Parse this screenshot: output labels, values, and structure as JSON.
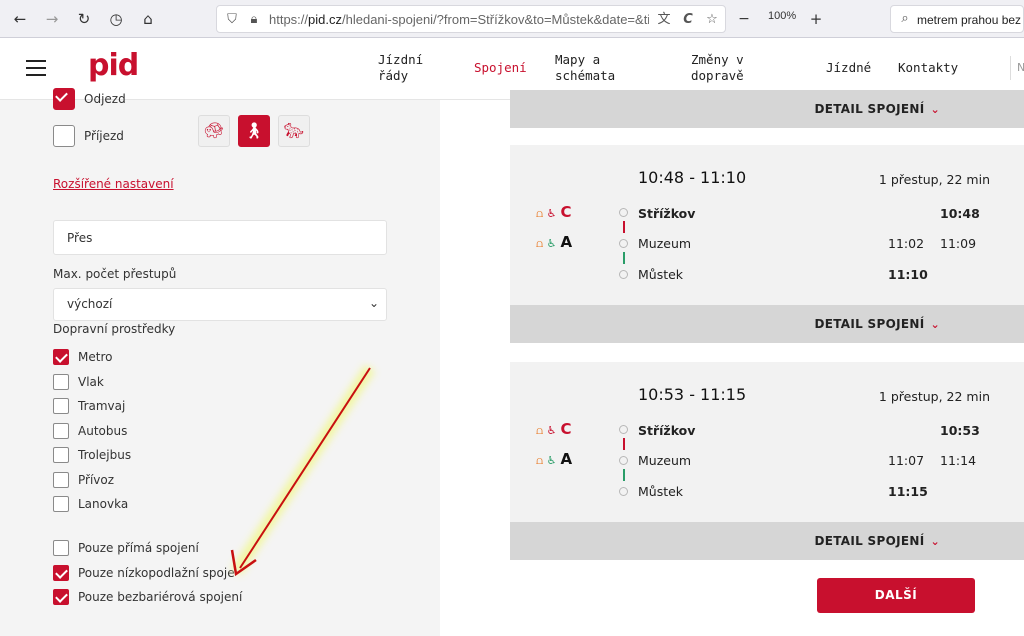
{
  "browser": {
    "url_prefix": "https://",
    "url_host": "pid.cz",
    "url_path": "/hledani-spojeni/?from=Střížkov&to=Můstek&date=&tim",
    "zoom": "100%",
    "search_text": "metrem prahou bez"
  },
  "header": {
    "logo": "pid",
    "nav": [
      {
        "label": "Jízdní\nřády"
      },
      {
        "label": "Spojení"
      },
      {
        "label": "Mapy a\nschémata"
      },
      {
        "label": "Změny v\ndopravě"
      },
      {
        "label": "Jízdné"
      },
      {
        "label": "Kontakty"
      }
    ]
  },
  "form": {
    "odjezd_label": "Odjezd",
    "prijezd_label": "Příjezd",
    "advanced_link": "Rozšířené nastavení",
    "via_placeholder": "Přes",
    "max_transfers_label": "Max. počet přestupů",
    "max_transfers_value": "výchozí",
    "transport_label": "Dopravní prostředky",
    "modes": [
      {
        "label": "Metro",
        "checked": true
      },
      {
        "label": "Vlak",
        "checked": false
      },
      {
        "label": "Tramvaj",
        "checked": false
      },
      {
        "label": "Autobus",
        "checked": false
      },
      {
        "label": "Trolejbus",
        "checked": false
      },
      {
        "label": "Přívoz",
        "checked": false
      },
      {
        "label": "Lanovka",
        "checked": false
      }
    ],
    "options": [
      {
        "label": "Pouze přímá spojení",
        "checked": false
      },
      {
        "label": "Pouze nízkopodlažní spoje",
        "checked": true
      },
      {
        "label": "Pouze bezbariérová spojení",
        "checked": true
      }
    ]
  },
  "results": {
    "detail_label": "DETAIL SPOJENÍ",
    "connections": [
      {
        "time_range": "10:48 - 11:10",
        "summary": "1 přestup, 22 min",
        "lines": [
          "C",
          "A"
        ],
        "stops": [
          {
            "name": "Střížkov",
            "arr": "",
            "dep": "10:48"
          },
          {
            "name": "Muzeum",
            "arr": "11:02",
            "dep": "11:09"
          },
          {
            "name": "Můstek",
            "arr": "11:10",
            "dep": ""
          }
        ]
      },
      {
        "time_range": "10:53 - 11:15",
        "summary": "1 přestup, 22 min",
        "lines": [
          "C",
          "A"
        ],
        "stops": [
          {
            "name": "Střížkov",
            "arr": "",
            "dep": "10:53"
          },
          {
            "name": "Muzeum",
            "arr": "11:07",
            "dep": "11:14"
          },
          {
            "name": "Můstek",
            "arr": "11:15",
            "dep": ""
          }
        ]
      }
    ],
    "next_label": "DALŠÍ"
  },
  "colors": {
    "brand": "#c8102e",
    "line_a": "#2a9d68",
    "line_c": "#c8102e"
  }
}
